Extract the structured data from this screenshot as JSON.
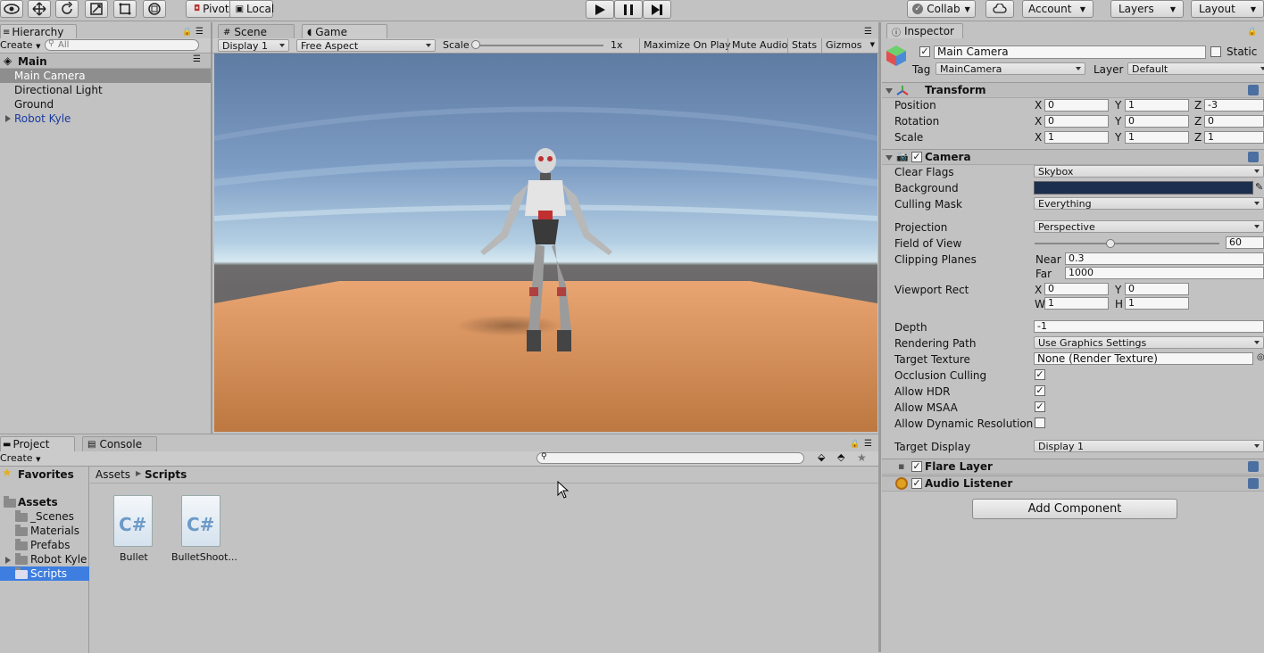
{
  "toolbar": {
    "pivot": "Pivot",
    "local": "Local",
    "collab": "Collab",
    "account": "Account",
    "layers": "Layers",
    "layout": "Layout",
    "play_icon": "play-icon",
    "pause_icon": "pause-icon",
    "step_icon": "step-icon"
  },
  "hierarchy": {
    "tab": "Hierarchy",
    "create": "Create",
    "search_placeholder": "All",
    "scene": "Main",
    "items": [
      "Main Camera",
      "Directional Light",
      "Ground",
      "Robot Kyle"
    ]
  },
  "view": {
    "tabs": [
      "Scene",
      "Game"
    ],
    "display": "Display 1",
    "aspect": "Free Aspect",
    "scale_label": "Scale",
    "scale_value": "1x",
    "buttons": [
      "Maximize On Play",
      "Mute Audio",
      "Stats",
      "Gizmos"
    ]
  },
  "project": {
    "tabs": [
      "Project",
      "Console"
    ],
    "create": "Create",
    "favorites": "Favorites",
    "assets": "Assets",
    "folders": [
      "_Scenes",
      "Materials",
      "Prefabs",
      "Robot Kyle",
      "Scripts"
    ],
    "breadcrumb": [
      "Assets",
      "Scripts"
    ],
    "files": [
      "Bullet",
      "BulletShoot..."
    ],
    "file_glyph": "C#"
  },
  "inspector": {
    "tab": "Inspector",
    "object_name": "Main Camera",
    "static": "Static",
    "tag_label": "Tag",
    "tag": "MainCamera",
    "layer_label": "Layer",
    "layer": "Default",
    "transform": {
      "title": "Transform",
      "rows": [
        {
          "label": "Position",
          "x": "0",
          "y": "1",
          "z": "-3"
        },
        {
          "label": "Rotation",
          "x": "0",
          "y": "0",
          "z": "0"
        },
        {
          "label": "Scale",
          "x": "1",
          "y": "1",
          "z": "1"
        }
      ]
    },
    "camera": {
      "title": "Camera",
      "clear_flags_label": "Clear Flags",
      "clear_flags": "Skybox",
      "background_label": "Background",
      "background_color": "#1c2f4f",
      "culling_mask_label": "Culling Mask",
      "culling_mask": "Everything",
      "projection_label": "Projection",
      "projection": "Perspective",
      "fov_label": "Field of View",
      "fov": "60",
      "fov_fraction": 0.41,
      "clipping_label": "Clipping Planes",
      "near_label": "Near",
      "near": "0.3",
      "far_label": "Far",
      "far": "1000",
      "viewport_label": "Viewport Rect",
      "vx": "0",
      "vy": "0",
      "vw": "1",
      "vh": "1",
      "depth_label": "Depth",
      "depth": "-1",
      "rendering_path_label": "Rendering Path",
      "rendering_path": "Use Graphics Settings",
      "target_texture_label": "Target Texture",
      "target_texture": "None (Render Texture)",
      "occlusion_label": "Occlusion Culling",
      "hdr_label": "Allow HDR",
      "msaa_label": "Allow MSAA",
      "dynres_label": "Allow Dynamic Resolution",
      "target_display_label": "Target Display",
      "target_display": "Display 1"
    },
    "flare_layer": "Flare Layer",
    "audio_listener": "Audio Listener",
    "add_component": "Add Component",
    "axis": {
      "x": "X",
      "y": "Y",
      "z": "Z",
      "w": "W",
      "h": "H"
    }
  }
}
